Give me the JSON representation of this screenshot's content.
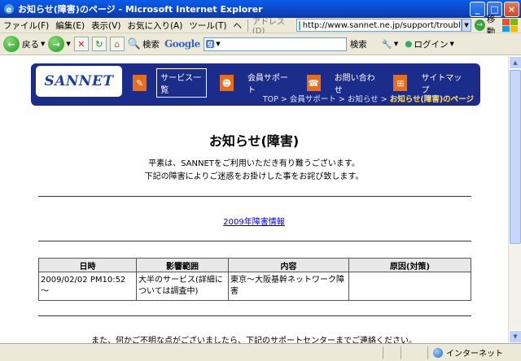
{
  "window": {
    "title": "お知らせ(障害)のページ - Microsoft Internet Explorer"
  },
  "menu": {
    "items": [
      "ファイル(F)",
      "編集(E)",
      "表示(V)",
      "お気に入り(A)",
      "ツール(T)",
      "ヘ"
    ],
    "address_label": "アドレス(D)",
    "url": "http://www.sannet.ne.jp/support/trouble/",
    "go_label": "移動"
  },
  "toolbar": {
    "back": "戻る",
    "search": "検索",
    "google": "Google",
    "g": "g",
    "gsearch": "検索",
    "login": "ログイン"
  },
  "site": {
    "logo": "SANNET",
    "nav": [
      "サービス一覧",
      "会員サポート",
      "お問い合わせ",
      "サイトマップ"
    ],
    "breadcrumb": [
      "TOP",
      "会員サポート",
      "お知らせ"
    ],
    "breadcrumb_current": "お知らせ(障害)のページ"
  },
  "content": {
    "title": "お知らせ(障害)",
    "intro1": "平素は、SANNETをご利用いただき有り難うございます。",
    "intro2": "下記の障害によりご迷惑をお掛けした事をお詫び致します。",
    "link": "2009年障害情報",
    "table": {
      "headers": [
        "日時",
        "影響範囲",
        "内容",
        "原因(対策)"
      ],
      "rows": [
        [
          "2009/02/02 PM10:52 ～",
          "大半のサービス(詳細については調査中)",
          "東京～大阪基幹ネットワーク障害",
          ""
        ]
      ]
    },
    "footer": "また、何かご不明な点がございましたら、下記のサポートセンターまでご連絡ください。"
  },
  "status": {
    "zone": "インターネット"
  },
  "colors": {
    "titlebar": "#0a46c5",
    "header": "#1c2c8a",
    "nav_icon": "#e86d16",
    "link": "#0000cc"
  }
}
